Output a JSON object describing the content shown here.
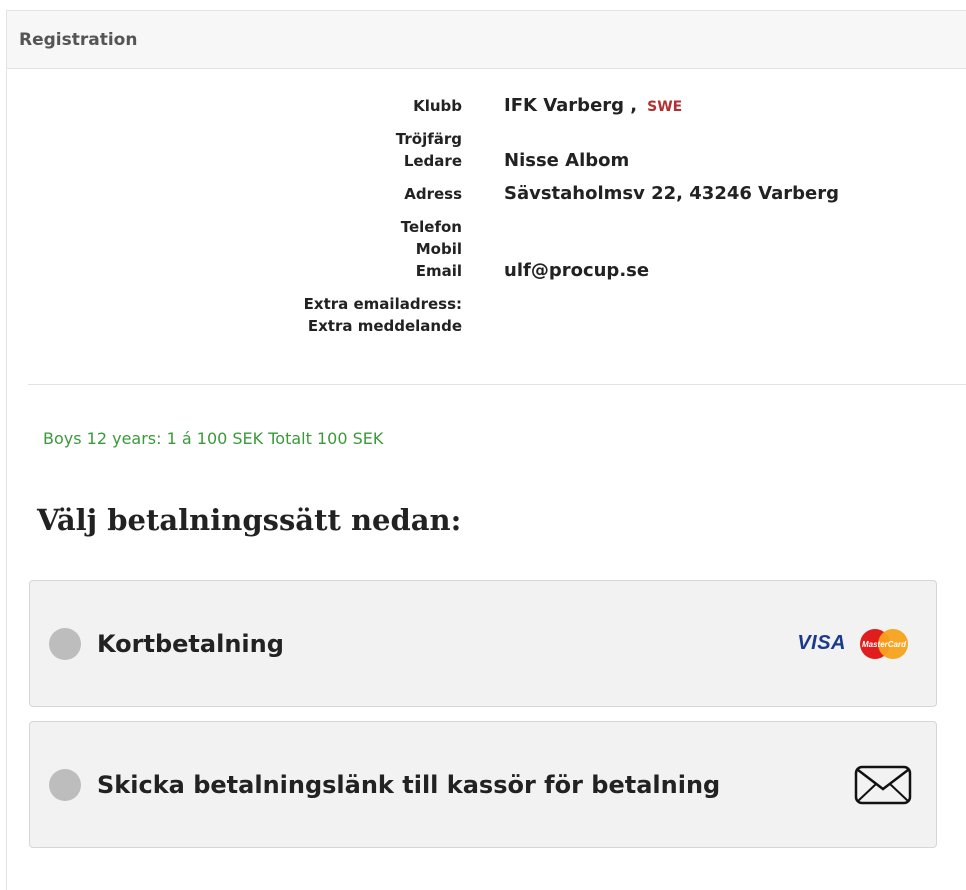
{
  "panel": {
    "title": "Registration"
  },
  "details": {
    "rows": [
      {
        "label": "Klubb",
        "value": "IFK Varberg ,",
        "extra": "SWE"
      },
      {
        "label": "Tröjfärg",
        "value": ""
      },
      {
        "label": "Ledare",
        "value": "Nisse Albom"
      },
      {
        "label": "Adress",
        "value": "Sävstaholmsv 22, 43246 Varberg"
      },
      {
        "label": "Telefon",
        "value": ""
      },
      {
        "label": "Mobil",
        "value": ""
      },
      {
        "label": "Email",
        "value": "ulf@procup.se"
      },
      {
        "label": "Extra emailadress:",
        "value": ""
      },
      {
        "label": "Extra meddelande",
        "value": ""
      }
    ]
  },
  "summary": "Boys 12 years:  1 á 100 SEK Totalt 100 SEK",
  "payment": {
    "heading": "Välj betalningssätt nedan:",
    "options": [
      {
        "label": "Kortbetalning",
        "brand_visa": "VISA",
        "brand_mc": "MasterCard"
      },
      {
        "label": "Skicka betalningslänk till kassör för betalning"
      }
    ]
  },
  "colors": {
    "summary": "#3a9a3a",
    "country": "#b03030",
    "radio": "#bdbdbd"
  },
  "icons": {
    "card": "visa-mastercard-logos",
    "mail": "envelope-icon"
  }
}
